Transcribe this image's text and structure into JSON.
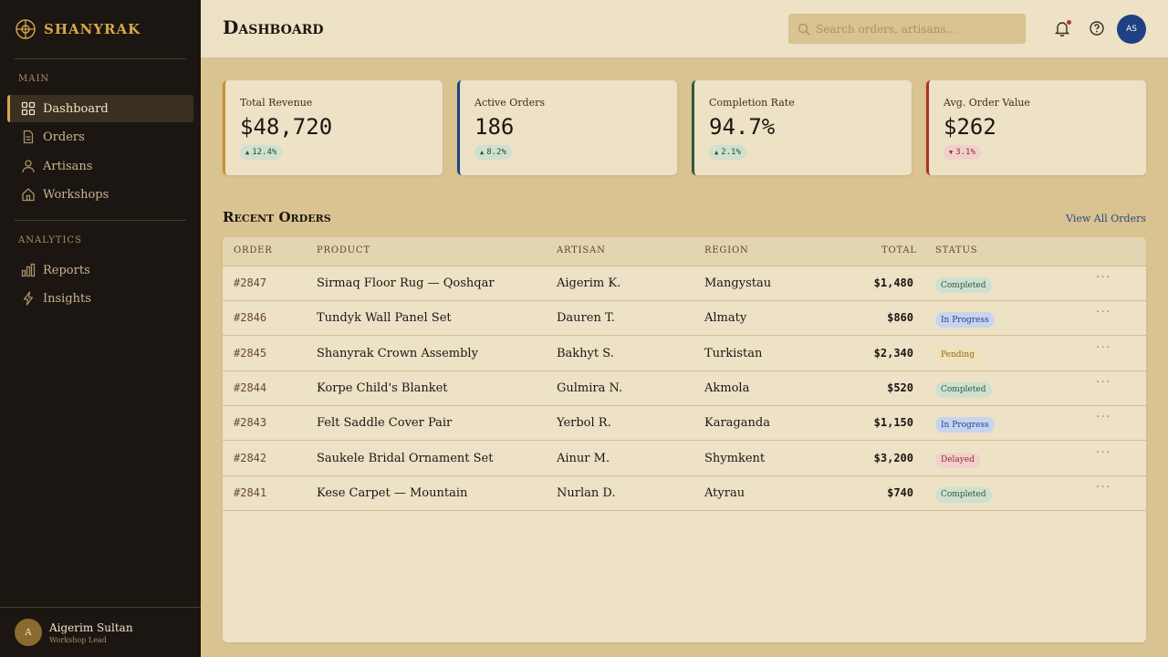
{
  "brand": {
    "name": "SHANYRAK"
  },
  "sidebar": {
    "sections": [
      {
        "label": "MAIN"
      },
      {
        "label": "ANALYTICS"
      }
    ],
    "items": [
      {
        "label": "Dashboard",
        "icon": "grid-icon"
      },
      {
        "label": "Orders",
        "icon": "document-icon"
      },
      {
        "label": "Artisans",
        "icon": "user-icon"
      },
      {
        "label": "Workshops",
        "icon": "home-icon"
      },
      {
        "label": "Reports",
        "icon": "bar-chart-icon"
      },
      {
        "label": "Insights",
        "icon": "lightning-icon"
      }
    ],
    "user": {
      "initial": "A",
      "name": "Aigerim Sultan",
      "role": "Workshop Lead"
    }
  },
  "header": {
    "title": "Dashboard",
    "search_placeholder": "Search orders, artisans...",
    "avatar_initials": "AS"
  },
  "kpis": [
    {
      "label": "Total Revenue",
      "value": "$48,720",
      "delta": "12.4%",
      "direction": "up",
      "accent": "#c99033"
    },
    {
      "label": "Active Orders",
      "value": "186",
      "delta": "8.2%",
      "direction": "up",
      "accent": "#1e4185"
    },
    {
      "label": "Completion Rate",
      "value": "94.7%",
      "delta": "2.1%",
      "direction": "up",
      "accent": "#2e5a3e"
    },
    {
      "label": "Avg. Order Value",
      "value": "$262",
      "delta": "3.1%",
      "direction": "down",
      "accent": "#a83226"
    }
  ],
  "orders": {
    "title": "Recent Orders",
    "view_all": "View All Orders",
    "columns": [
      "ORDER",
      "PRODUCT",
      "ARTISAN",
      "REGION",
      "TOTAL",
      "STATUS"
    ],
    "rows": [
      {
        "order": "#2847",
        "product": "Sirmaq Floor Rug — Qoshqar",
        "artisan": "Aigerim K.",
        "region": "Mangystau",
        "total": "$1,480",
        "status": "Completed"
      },
      {
        "order": "#2846",
        "product": "Tundyk Wall Panel Set",
        "artisan": "Dauren T.",
        "region": "Almaty",
        "total": "$860",
        "status": "In Progress"
      },
      {
        "order": "#2845",
        "product": "Shanyrak Crown Assembly",
        "artisan": "Bakhyt S.",
        "region": "Turkistan",
        "total": "$2,340",
        "status": "Pending"
      },
      {
        "order": "#2844",
        "product": "Korpe Child's Blanket",
        "artisan": "Gulmira N.",
        "region": "Akmola",
        "total": "$520",
        "status": "Completed"
      },
      {
        "order": "#2843",
        "product": "Felt Saddle Cover Pair",
        "artisan": "Yerbol R.",
        "region": "Karaganda",
        "total": "$1,150",
        "status": "In Progress"
      },
      {
        "order": "#2842",
        "product": "Saukele Bridal Ornament Set",
        "artisan": "Ainur M.",
        "region": "Shymkent",
        "total": "$3,200",
        "status": "Delayed"
      },
      {
        "order": "#2841",
        "product": "Kese Carpet — Mountain",
        "artisan": "Nurlan D.",
        "region": "Atyrau",
        "total": "$740",
        "status": "Completed"
      }
    ]
  }
}
